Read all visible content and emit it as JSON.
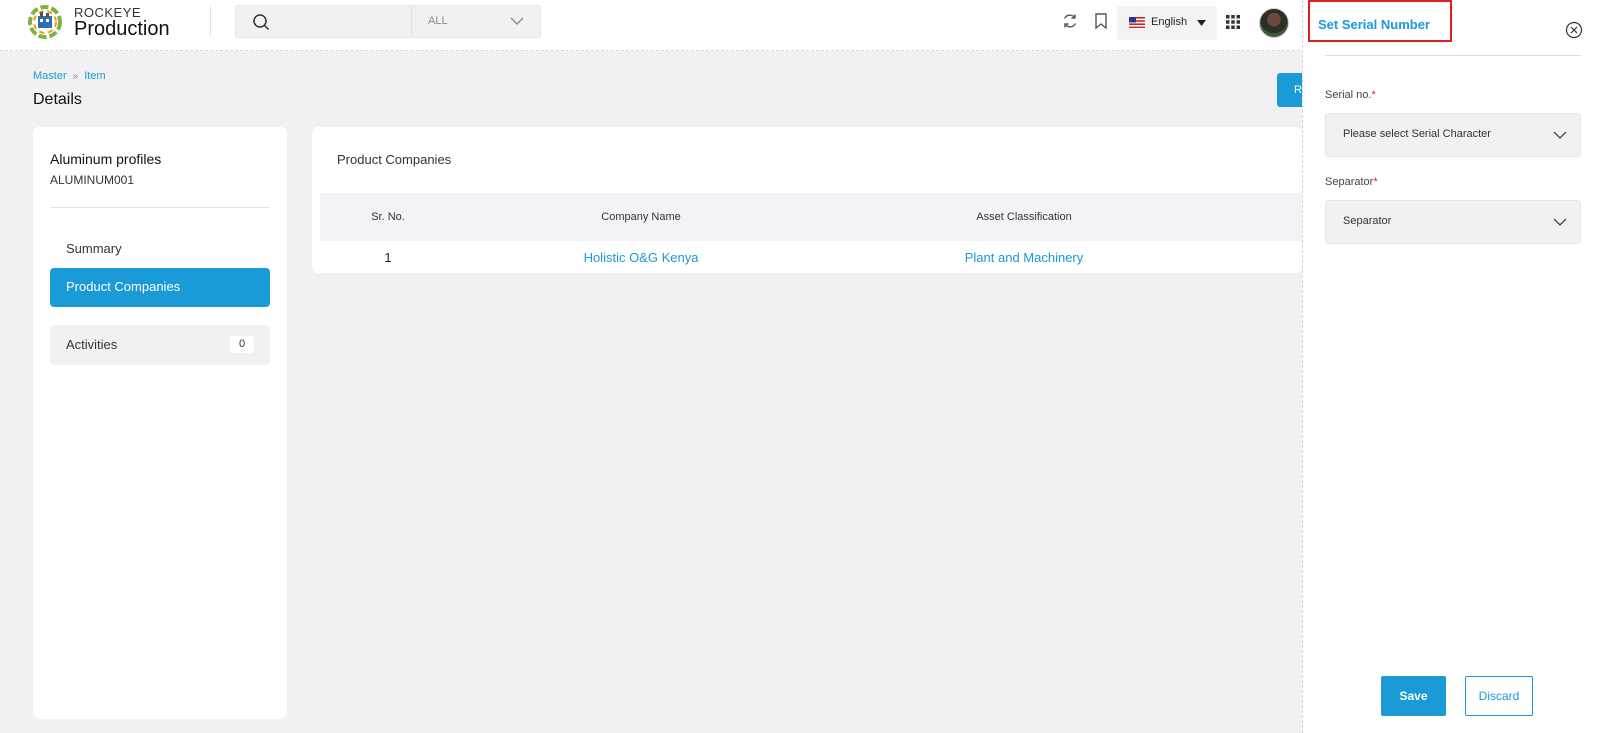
{
  "header": {
    "brand_top": "ROCKEYE",
    "brand_main": "Production",
    "search": {
      "placeholder": "",
      "category": "ALL"
    },
    "language": "English"
  },
  "breadcrumb": {
    "items": [
      "Master",
      "Item"
    ]
  },
  "page_title": "Details",
  "top_action_label": "R",
  "item": {
    "name": "Aluminum profiles",
    "code": "ALUMINUM001"
  },
  "nav": {
    "summary": "Summary",
    "product_companies": "Product Companies",
    "activities": "Activities",
    "activities_count": "0"
  },
  "product_companies": {
    "title": "Product Companies",
    "columns": [
      "Sr. No.",
      "Company Name",
      "Asset Classification"
    ],
    "rows": [
      {
        "sr": "1",
        "company": "Holistic O&G Kenya",
        "classification": "Plant and Machinery"
      }
    ]
  },
  "drawer": {
    "title": "Set Serial Number",
    "serial_label": "Serial no.",
    "serial_value": "Please select Serial Character",
    "separator_label": "Separator",
    "separator_value": "Separator",
    "required_mark": "*",
    "save_label": "Save",
    "discard_label": "Discard"
  },
  "colors": {
    "accent": "#1a9ad6",
    "highlight": "#e02020",
    "background": "#f1f1f1"
  }
}
